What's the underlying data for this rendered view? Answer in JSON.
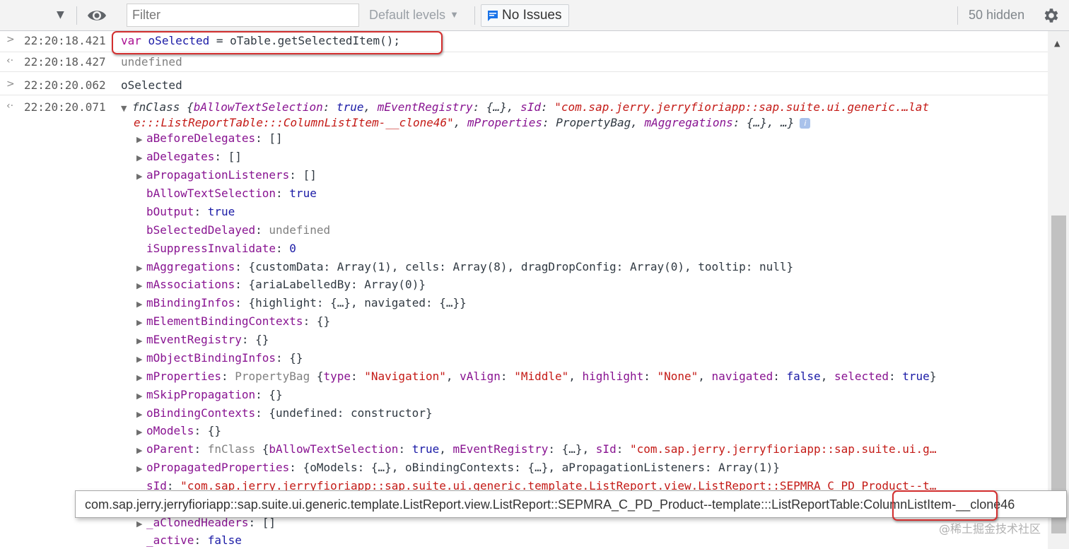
{
  "toolbar": {
    "filter_placeholder": "Filter",
    "levels_label": "Default levels",
    "issues_label": "No Issues",
    "hidden_label": "50 hidden"
  },
  "rows": {
    "r1": {
      "time": "22:20:18.421",
      "code_kw": "var",
      "code_var": "oSelected",
      "code_rest": " = oTable.getSelectedItem();"
    },
    "r2": {
      "time": "22:20:18.427",
      "result": "undefined"
    },
    "r3": {
      "time": "22:20:20.062",
      "code": "oSelected"
    },
    "r4": {
      "time": "22:20:20.071",
      "class": "fnClass",
      "line1": {
        "open": " {",
        "k1": "bAllowTextSelection",
        "v1": "true",
        "k2": "mEventRegistry",
        "v2": "{…}",
        "k3": "sId",
        "v3": "\"com.sap.jerry.jerryfioriapp::sap.suite.ui.generic.…lat"
      },
      "line2": {
        "v3b": "e:::ListReportTable:::ColumnListItem-__clone46\"",
        "k4": "mProperties",
        "v4": "PropertyBag",
        "k5": "mAggregations",
        "v5": "{…}",
        "tail": ", …}"
      }
    }
  },
  "props": {
    "aBeforeDelegates": {
      "k": "aBeforeDelegates",
      "v": "[]"
    },
    "aDelegates": {
      "k": "aDelegates",
      "v": "[]"
    },
    "aPropagationListeners": {
      "k": "aPropagationListeners",
      "v": "[]"
    },
    "bAllowTextSelection": {
      "k": "bAllowTextSelection",
      "v": "true"
    },
    "bOutput": {
      "k": "bOutput",
      "v": "true"
    },
    "bSelectedDelayed": {
      "k": "bSelectedDelayed",
      "v": "undefined"
    },
    "iSuppressInvalidate": {
      "k": "iSuppressInvalidate",
      "v": "0"
    },
    "mAggregations": {
      "k": "mAggregations",
      "v": "{customData: Array(1), cells: Array(8), dragDropConfig: Array(0), tooltip: null}"
    },
    "mAssociations": {
      "k": "mAssociations",
      "v": "{ariaLabelledBy: Array(0)}"
    },
    "mBindingInfos": {
      "k": "mBindingInfos",
      "v": "{highlight: {…}, navigated: {…}}"
    },
    "mElementBindingContexts": {
      "k": "mElementBindingContexts",
      "v": "{}"
    },
    "mEventRegistry": {
      "k": "mEventRegistry",
      "v": "{}"
    },
    "mObjectBindingInfos": {
      "k": "mObjectBindingInfos",
      "v": "{}"
    },
    "mProperties": {
      "k": "mProperties",
      "cls": "PropertyBag",
      "p1k": "type",
      "p1v": "\"Navigation\"",
      "p2k": "vAlign",
      "p2v": "\"Middle\"",
      "p3k": "highlight",
      "p3v": "\"None\"",
      "p4k": "navigated",
      "p4v": "false",
      "p5k": "selected",
      "p5v": "true"
    },
    "mSkipPropagation": {
      "k": "mSkipPropagation",
      "v": "{}"
    },
    "oBindingContexts": {
      "k": "oBindingContexts",
      "v": "{undefined: constructor}"
    },
    "oModels": {
      "k": "oModels",
      "v": "{}"
    },
    "oParent": {
      "k": "oParent",
      "cls": "fnClass",
      "b1k": "bAllowTextSelection",
      "b1v": "true",
      "b2k": "mEventRegistry",
      "b2v": "{…}",
      "b3k": "sId",
      "b3v": "\"com.sap.jerry.jerryfioriapp::sap.suite.ui.g…"
    },
    "oPropagatedProperties": {
      "k": "oPropagatedProperties",
      "v": "{oModels: {…}, oBindingContexts: {…}, aPropagationListeners: Array(1)}"
    },
    "sId": {
      "k": "sId",
      "v": "\"com.sap.jerry.jerryfioriapp::sap.suite.ui.generic.template.ListReport.view.ListReport::SEPMRA_C_PD_Product--t…"
    },
    "_aClonedHeaders": {
      "k": "_aClonedHeaders",
      "v": "[]"
    },
    "_active": {
      "k": "_active",
      "v": "false"
    }
  },
  "tooltip": {
    "prefix": "com.sap.jerry.jerryfioriapp::sap.suite.ui.generic.template.ListReport.view.ListReport::SEPMRA_C_PD_Product--template:::ListReportTable:",
    "highlight": "ColumnListItem",
    "suffix": "-__clone46"
  },
  "watermark": "@稀土掘金技术社区",
  "colors": {
    "keyword": "#aa0d91",
    "property_key": "#881391",
    "string": "#c41a16",
    "boolean_number": "#1a1aa6",
    "highlight_box": "#d32f2f"
  }
}
